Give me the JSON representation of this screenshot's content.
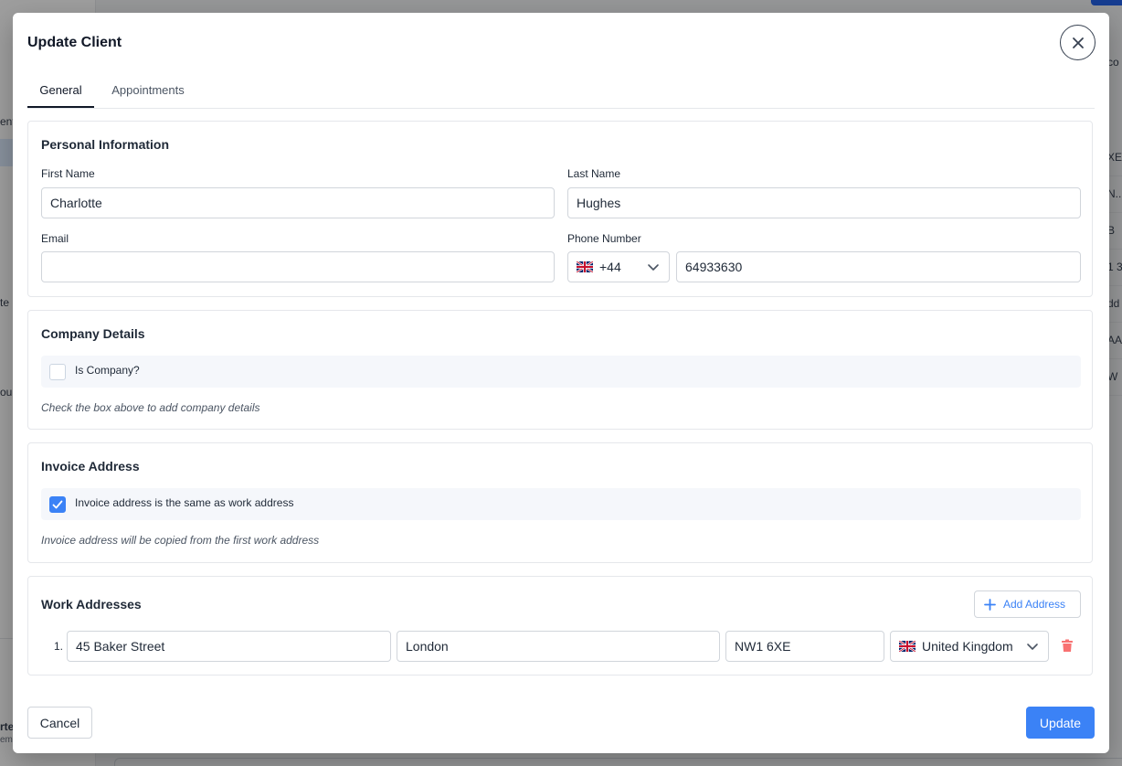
{
  "background": {
    "sidebar_fragments": [
      "ent",
      "te",
      "our",
      "rte",
      "em"
    ],
    "table_fragments": [
      "co",
      "XE",
      "N..",
      "B",
      "1 3",
      "dd",
      "AA",
      "W"
    ]
  },
  "modal": {
    "title": "Update Client",
    "close_icon": "close-icon",
    "tabs": [
      {
        "label": "General",
        "active": true
      },
      {
        "label": "Appointments",
        "active": false
      }
    ]
  },
  "personal": {
    "title": "Personal Information",
    "first_name_label": "First Name",
    "first_name_value": "Charlotte",
    "last_name_label": "Last Name",
    "last_name_value": "Hughes",
    "email_label": "Email",
    "email_value": "",
    "phone_label": "Phone Number",
    "phone_country_flag": "uk-flag-icon",
    "phone_code": "+44",
    "phone_number": "64933630"
  },
  "company": {
    "title": "Company Details",
    "checkbox_label": "Is Company?",
    "checked": false,
    "hint": "Check the box above to add company details"
  },
  "invoice": {
    "title": "Invoice Address",
    "checkbox_label": "Invoice address is the same as work address",
    "checked": true,
    "hint": "Invoice address will be copied from the first work address"
  },
  "work": {
    "title": "Work Addresses",
    "add_label": "Add Address",
    "addresses": [
      {
        "number": "1.",
        "street": "45 Baker Street",
        "city": "London",
        "postcode": "NW1 6XE",
        "country": "United Kingdom",
        "country_flag": "uk-flag-icon"
      }
    ]
  },
  "footer": {
    "cancel_label": "Cancel",
    "update_label": "Update"
  },
  "colors": {
    "accent": "#3b82f6",
    "danger": "#f87171",
    "overlay": "#9a9a9a"
  }
}
